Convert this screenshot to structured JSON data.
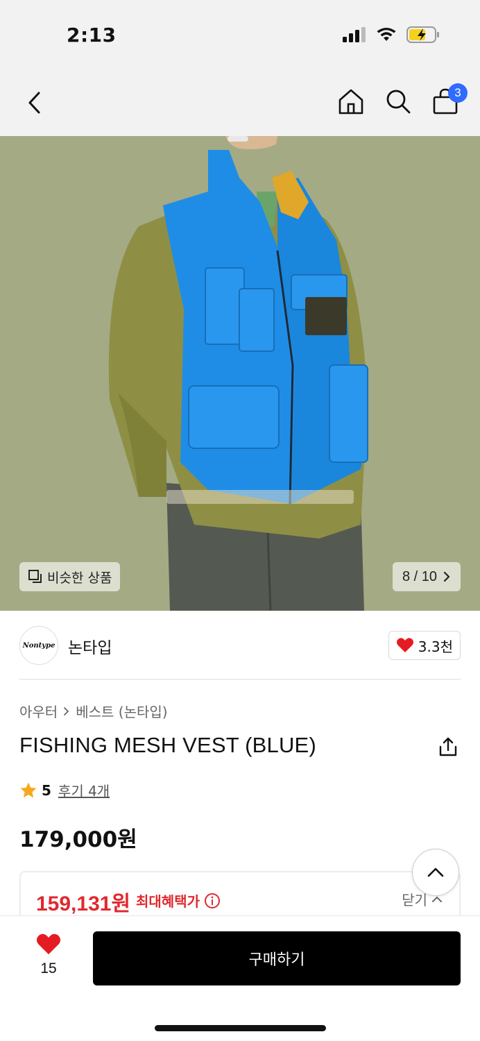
{
  "status_bar": {
    "time": "2:13"
  },
  "nav": {
    "cart_count": "3"
  },
  "image": {
    "similar_label": "비슷한 상품",
    "pager": "8 / 10"
  },
  "brand": {
    "logo_text": "Nontype",
    "name": "논타입",
    "likes": "3.3천"
  },
  "breadcrumb": {
    "category": "아우터",
    "subcategory": "베스트 (논타입)"
  },
  "product": {
    "title": "FISHING MESH VEST (BLUE)",
    "rating": "5",
    "reviews": "후기 4개",
    "price": "179,000원"
  },
  "benefit": {
    "price": "159,131원",
    "label": "최대혜택가",
    "close_label": "닫기"
  },
  "bottom_bar": {
    "wish_count": "15",
    "buy_label": "구매하기"
  },
  "colors": {
    "accent_red": "#e0292e",
    "badge_blue": "#2f6bff",
    "photo_background": "#a4aa84",
    "vest_blue": "#1f8de6"
  },
  "icons": [
    "back-icon",
    "home-icon",
    "search-icon",
    "cart-icon",
    "similar-icon",
    "chevron-right-icon",
    "heart-icon",
    "share-icon",
    "star-icon",
    "info-icon",
    "chevron-up-icon"
  ]
}
